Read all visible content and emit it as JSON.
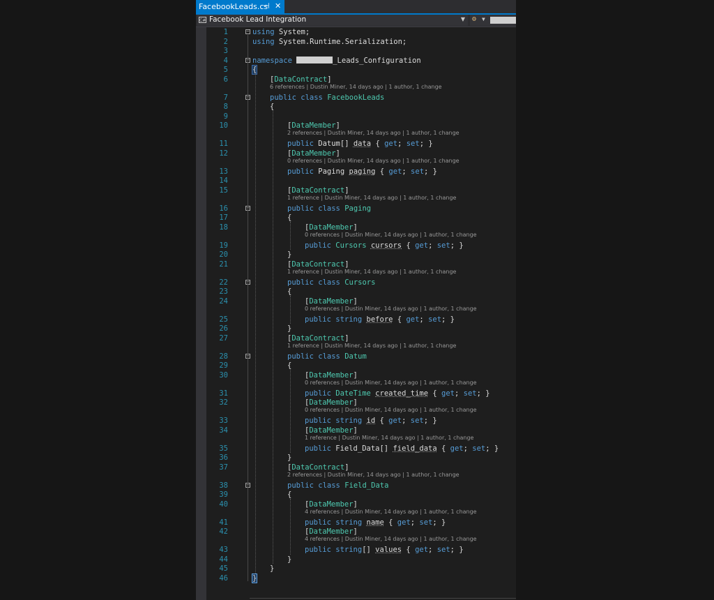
{
  "tab": {
    "title": "FacebookLeads.cs",
    "pin": "⊣",
    "close": "✕"
  },
  "nav": {
    "project": "Facebook Lead Integration",
    "project_icon": "C#"
  },
  "code_lines": [
    {
      "n": "1",
      "kind": "code",
      "indent": 0,
      "tokens": [
        {
          "t": "using",
          "c": "kw"
        },
        {
          "t": " System;"
        }
      ]
    },
    {
      "n": "2",
      "kind": "code",
      "indent": 0,
      "tokens": [
        {
          "t": "using",
          "c": "kw"
        },
        {
          "t": " System.Runtime.Serialization;"
        }
      ]
    },
    {
      "n": "3",
      "kind": "code",
      "indent": 0,
      "tokens": []
    },
    {
      "n": "4",
      "kind": "code",
      "indent": 0,
      "tokens": [
        {
          "t": "namespace",
          "c": "kw"
        },
        {
          "t": " "
        },
        {
          "t": "",
          "c": "redact"
        },
        {
          "t": "_Leads_Configuration"
        }
      ]
    },
    {
      "n": "5",
      "kind": "code",
      "indent": 0,
      "tokens": [
        {
          "t": "{",
          "c": "hl"
        }
      ]
    },
    {
      "n": "6",
      "kind": "code",
      "indent": 1,
      "tokens": [
        {
          "t": "["
        },
        {
          "t": "DataContract",
          "c": "ty"
        },
        {
          "t": "]"
        }
      ],
      "lens": "6 references | Dustin Miner, 14 days ago | 1 author, 1 change"
    },
    {
      "n": "7",
      "kind": "code",
      "indent": 1,
      "tokens": [
        {
          "t": "public",
          "c": "kw"
        },
        {
          "t": " "
        },
        {
          "t": "class",
          "c": "kw"
        },
        {
          "t": " "
        },
        {
          "t": "FacebookLeads",
          "c": "ty"
        }
      ]
    },
    {
      "n": "8",
      "kind": "code",
      "indent": 1,
      "tokens": [
        {
          "t": "{"
        }
      ]
    },
    {
      "n": "9",
      "kind": "code",
      "indent": 1,
      "tokens": []
    },
    {
      "n": "10",
      "kind": "code",
      "indent": 2,
      "tokens": [
        {
          "t": "["
        },
        {
          "t": "DataMember",
          "c": "ty"
        },
        {
          "t": "]"
        }
      ],
      "lens": "2 references | Dustin Miner, 14 days ago | 1 author, 1 change"
    },
    {
      "n": "11",
      "kind": "code",
      "indent": 2,
      "tokens": [
        {
          "t": "public",
          "c": "kw"
        },
        {
          "t": " Datum[] "
        },
        {
          "t": "data",
          "c": "ref"
        },
        {
          "t": " { "
        },
        {
          "t": "get",
          "c": "kw"
        },
        {
          "t": "; "
        },
        {
          "t": "set",
          "c": "kw"
        },
        {
          "t": "; }"
        }
      ]
    },
    {
      "n": "12",
      "kind": "code",
      "indent": 2,
      "tokens": [
        {
          "t": "["
        },
        {
          "t": "DataMember",
          "c": "ty"
        },
        {
          "t": "]"
        }
      ],
      "lens": "0 references | Dustin Miner, 14 days ago | 1 author, 1 change"
    },
    {
      "n": "13",
      "kind": "code",
      "indent": 2,
      "tokens": [
        {
          "t": "public",
          "c": "kw"
        },
        {
          "t": " Paging "
        },
        {
          "t": "paging",
          "c": "ref"
        },
        {
          "t": " { "
        },
        {
          "t": "get",
          "c": "kw"
        },
        {
          "t": "; "
        },
        {
          "t": "set",
          "c": "kw"
        },
        {
          "t": "; }"
        }
      ]
    },
    {
      "n": "14",
      "kind": "code",
      "indent": 2,
      "tokens": []
    },
    {
      "n": "15",
      "kind": "code",
      "indent": 2,
      "tokens": [
        {
          "t": "["
        },
        {
          "t": "DataContract",
          "c": "ty"
        },
        {
          "t": "]"
        }
      ],
      "lens": "1 reference | Dustin Miner, 14 days ago | 1 author, 1 change"
    },
    {
      "n": "16",
      "kind": "code",
      "indent": 2,
      "tokens": [
        {
          "t": "public",
          "c": "kw"
        },
        {
          "t": " "
        },
        {
          "t": "class",
          "c": "kw"
        },
        {
          "t": " "
        },
        {
          "t": "Paging",
          "c": "ty"
        }
      ]
    },
    {
      "n": "17",
      "kind": "code",
      "indent": 2,
      "tokens": [
        {
          "t": "{"
        }
      ]
    },
    {
      "n": "18",
      "kind": "code",
      "indent": 3,
      "tokens": [
        {
          "t": "["
        },
        {
          "t": "DataMember",
          "c": "ty"
        },
        {
          "t": "]"
        }
      ],
      "lens": "0 references | Dustin Miner, 14 days ago | 1 author, 1 change"
    },
    {
      "n": "19",
      "kind": "code",
      "indent": 3,
      "tokens": [
        {
          "t": "public",
          "c": "kw"
        },
        {
          "t": " "
        },
        {
          "t": "Cursors",
          "c": "ty"
        },
        {
          "t": " "
        },
        {
          "t": "cursors",
          "c": "ref"
        },
        {
          "t": " { "
        },
        {
          "t": "get",
          "c": "kw"
        },
        {
          "t": "; "
        },
        {
          "t": "set",
          "c": "kw"
        },
        {
          "t": "; }"
        }
      ]
    },
    {
      "n": "20",
      "kind": "code",
      "indent": 2,
      "tokens": [
        {
          "t": "}"
        }
      ]
    },
    {
      "n": "21",
      "kind": "code",
      "indent": 2,
      "tokens": [
        {
          "t": "["
        },
        {
          "t": "DataContract",
          "c": "ty"
        },
        {
          "t": "]"
        }
      ],
      "lens": "1 reference | Dustin Miner, 14 days ago | 1 author, 1 change"
    },
    {
      "n": "22",
      "kind": "code",
      "indent": 2,
      "tokens": [
        {
          "t": "public",
          "c": "kw"
        },
        {
          "t": " "
        },
        {
          "t": "class",
          "c": "kw"
        },
        {
          "t": " "
        },
        {
          "t": "Cursors",
          "c": "ty"
        }
      ]
    },
    {
      "n": "23",
      "kind": "code",
      "indent": 2,
      "tokens": [
        {
          "t": "{"
        }
      ]
    },
    {
      "n": "24",
      "kind": "code",
      "indent": 3,
      "tokens": [
        {
          "t": "["
        },
        {
          "t": "DataMember",
          "c": "ty"
        },
        {
          "t": "]"
        }
      ],
      "lens": "0 references | Dustin Miner, 14 days ago | 1 author, 1 change"
    },
    {
      "n": "25",
      "kind": "code",
      "indent": 3,
      "tokens": [
        {
          "t": "public",
          "c": "kw"
        },
        {
          "t": " "
        },
        {
          "t": "string",
          "c": "kw"
        },
        {
          "t": " "
        },
        {
          "t": "before",
          "c": "ref"
        },
        {
          "t": " { "
        },
        {
          "t": "get",
          "c": "kw"
        },
        {
          "t": "; "
        },
        {
          "t": "set",
          "c": "kw"
        },
        {
          "t": "; }"
        }
      ]
    },
    {
      "n": "26",
      "kind": "code",
      "indent": 2,
      "tokens": [
        {
          "t": "}"
        }
      ]
    },
    {
      "n": "27",
      "kind": "code",
      "indent": 2,
      "tokens": [
        {
          "t": "["
        },
        {
          "t": "DataContract",
          "c": "ty"
        },
        {
          "t": "]"
        }
      ],
      "lens": "1 reference | Dustin Miner, 14 days ago | 1 author, 1 change"
    },
    {
      "n": "28",
      "kind": "code",
      "indent": 2,
      "tokens": [
        {
          "t": "public",
          "c": "kw"
        },
        {
          "t": " "
        },
        {
          "t": "class",
          "c": "kw"
        },
        {
          "t": " "
        },
        {
          "t": "Datum",
          "c": "ty"
        }
      ]
    },
    {
      "n": "29",
      "kind": "code",
      "indent": 2,
      "tokens": [
        {
          "t": "{"
        }
      ]
    },
    {
      "n": "30",
      "kind": "code",
      "indent": 3,
      "tokens": [
        {
          "t": "["
        },
        {
          "t": "DataMember",
          "c": "ty"
        },
        {
          "t": "]"
        }
      ],
      "lens": "0 references | Dustin Miner, 14 days ago | 1 author, 1 change"
    },
    {
      "n": "31",
      "kind": "code",
      "indent": 3,
      "tokens": [
        {
          "t": "public",
          "c": "kw"
        },
        {
          "t": " "
        },
        {
          "t": "DateTime",
          "c": "ty"
        },
        {
          "t": " "
        },
        {
          "t": "created_time",
          "c": "ref"
        },
        {
          "t": " { "
        },
        {
          "t": "get",
          "c": "kw"
        },
        {
          "t": "; "
        },
        {
          "t": "set",
          "c": "kw"
        },
        {
          "t": "; }"
        }
      ]
    },
    {
      "n": "32",
      "kind": "code",
      "indent": 3,
      "tokens": [
        {
          "t": "["
        },
        {
          "t": "DataMember",
          "c": "ty"
        },
        {
          "t": "]"
        }
      ],
      "lens": "0 references | Dustin Miner, 14 days ago | 1 author, 1 change"
    },
    {
      "n": "33",
      "kind": "code",
      "indent": 3,
      "tokens": [
        {
          "t": "public",
          "c": "kw"
        },
        {
          "t": " "
        },
        {
          "t": "string",
          "c": "kw"
        },
        {
          "t": " "
        },
        {
          "t": "id",
          "c": "ref"
        },
        {
          "t": " { "
        },
        {
          "t": "get",
          "c": "kw"
        },
        {
          "t": "; "
        },
        {
          "t": "set",
          "c": "kw"
        },
        {
          "t": "; }"
        }
      ]
    },
    {
      "n": "34",
      "kind": "code",
      "indent": 3,
      "tokens": [
        {
          "t": "["
        },
        {
          "t": "DataMember",
          "c": "ty"
        },
        {
          "t": "]"
        }
      ],
      "lens": "1 reference | Dustin Miner, 14 days ago | 1 author, 1 change"
    },
    {
      "n": "35",
      "kind": "code",
      "indent": 3,
      "tokens": [
        {
          "t": "public",
          "c": "kw"
        },
        {
          "t": " Field_Data[] "
        },
        {
          "t": "field_data",
          "c": "ref"
        },
        {
          "t": " { "
        },
        {
          "t": "get",
          "c": "kw"
        },
        {
          "t": "; "
        },
        {
          "t": "set",
          "c": "kw"
        },
        {
          "t": "; }"
        }
      ]
    },
    {
      "n": "36",
      "kind": "code",
      "indent": 2,
      "tokens": [
        {
          "t": "}"
        }
      ]
    },
    {
      "n": "37",
      "kind": "code",
      "indent": 2,
      "tokens": [
        {
          "t": "["
        },
        {
          "t": "DataContract",
          "c": "ty"
        },
        {
          "t": "]"
        }
      ],
      "lens": "2 references | Dustin Miner, 14 days ago | 1 author, 1 change"
    },
    {
      "n": "38",
      "kind": "code",
      "indent": 2,
      "tokens": [
        {
          "t": "public",
          "c": "kw"
        },
        {
          "t": " "
        },
        {
          "t": "class",
          "c": "kw"
        },
        {
          "t": " "
        },
        {
          "t": "Field_Data",
          "c": "ty"
        }
      ]
    },
    {
      "n": "39",
      "kind": "code",
      "indent": 2,
      "tokens": [
        {
          "t": "{"
        }
      ]
    },
    {
      "n": "40",
      "kind": "code",
      "indent": 3,
      "tokens": [
        {
          "t": "["
        },
        {
          "t": "DataMember",
          "c": "ty"
        },
        {
          "t": "]"
        }
      ],
      "lens": "4 references | Dustin Miner, 14 days ago | 1 author, 1 change"
    },
    {
      "n": "41",
      "kind": "code",
      "indent": 3,
      "tokens": [
        {
          "t": "public",
          "c": "kw"
        },
        {
          "t": " "
        },
        {
          "t": "string",
          "c": "kw"
        },
        {
          "t": " "
        },
        {
          "t": "name",
          "c": "ref"
        },
        {
          "t": " { "
        },
        {
          "t": "get",
          "c": "kw"
        },
        {
          "t": "; "
        },
        {
          "t": "set",
          "c": "kw"
        },
        {
          "t": "; }"
        }
      ]
    },
    {
      "n": "42",
      "kind": "code",
      "indent": 3,
      "tokens": [
        {
          "t": "["
        },
        {
          "t": "DataMember",
          "c": "ty"
        },
        {
          "t": "]"
        }
      ],
      "lens": "4 references | Dustin Miner, 14 days ago | 1 author, 1 change"
    },
    {
      "n": "43",
      "kind": "code",
      "indent": 3,
      "tokens": [
        {
          "t": "public",
          "c": "kw"
        },
        {
          "t": " "
        },
        {
          "t": "string",
          "c": "kw"
        },
        {
          "t": "[] "
        },
        {
          "t": "values",
          "c": "ref"
        },
        {
          "t": " { "
        },
        {
          "t": "get",
          "c": "kw"
        },
        {
          "t": "; "
        },
        {
          "t": "set",
          "c": "kw"
        },
        {
          "t": "; }"
        }
      ]
    },
    {
      "n": "44",
      "kind": "code",
      "indent": 2,
      "tokens": [
        {
          "t": "}"
        }
      ]
    },
    {
      "n": "45",
      "kind": "code",
      "indent": 1,
      "tokens": [
        {
          "t": "}"
        }
      ]
    },
    {
      "n": "46",
      "kind": "code",
      "indent": 0,
      "tokens": [
        {
          "t": "}",
          "c": "caret"
        }
      ]
    }
  ],
  "folds": [
    "1",
    "4",
    "7",
    "16",
    "22",
    "28",
    "38"
  ],
  "colors": {
    "keyword": "#569cd6",
    "type": "#4ec9b0",
    "text": "#dcdcdc",
    "line_number": "#2b91af",
    "lens": "#999999",
    "accent": "#007acc"
  },
  "icons": {
    "project": "csharp-project-icon",
    "member": "member-icon",
    "pin": "pin-icon",
    "close": "close-icon",
    "fold": "collapse-icon"
  }
}
